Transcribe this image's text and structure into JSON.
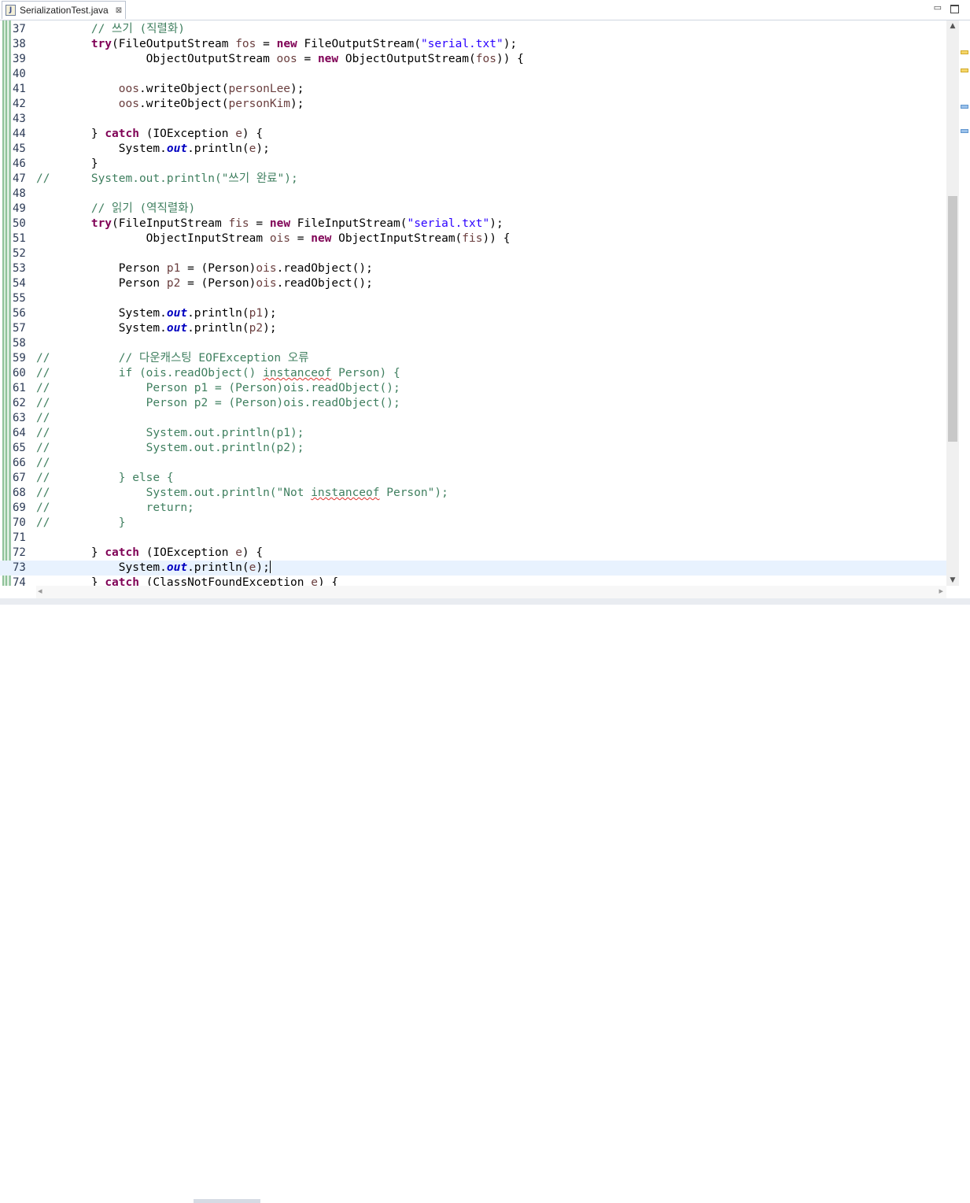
{
  "tab": {
    "title": "SerializationTest.java",
    "close": "⊠",
    "icon_text": "J"
  },
  "window": {
    "minimize": "▭",
    "maximize": "□"
  },
  "editor": {
    "current_line": 73,
    "lines": [
      {
        "n": "37",
        "html": "        <span class=\"cm\">// 쓰기 (직렬화)</span>"
      },
      {
        "n": "38",
        "html": "        <span class=\"kw\">try</span>(FileOutputStream <span class=\"var\">fos</span> = <span class=\"kw\">new</span> FileOutputStream(<span class=\"str\">\"serial.txt\"</span>);"
      },
      {
        "n": "39",
        "html": "                ObjectOutputStream <span class=\"var\">oos</span> = <span class=\"kw\">new</span> ObjectOutputStream(<span class=\"var\">fos</span>)) {"
      },
      {
        "n": "40",
        "html": ""
      },
      {
        "n": "41",
        "html": "            <span class=\"var\">oos</span>.writeObject(<span class=\"var\">personLee</span>);"
      },
      {
        "n": "42",
        "html": "            <span class=\"var\">oos</span>.writeObject(<span class=\"var\">personKim</span>);"
      },
      {
        "n": "43",
        "html": ""
      },
      {
        "n": "44",
        "html": "        } <span class=\"kw\">catch</span> (IOException <span class=\"var\">e</span>) {"
      },
      {
        "n": "45",
        "html": "            System.<span class=\"fld\">out</span>.println(<span class=\"var\">e</span>);"
      },
      {
        "n": "46",
        "html": "        }"
      },
      {
        "n": "47",
        "html": "<span class=\"cm\">//      System.out.println(\"쓰기 완료\");</span>"
      },
      {
        "n": "48",
        "html": ""
      },
      {
        "n": "49",
        "html": "        <span class=\"cm\">// 읽기 (역직렬화)</span>"
      },
      {
        "n": "50",
        "html": "        <span class=\"kw\">try</span>(FileInputStream <span class=\"var\">fis</span> = <span class=\"kw\">new</span> FileInputStream(<span class=\"str\">\"serial.txt\"</span>);"
      },
      {
        "n": "51",
        "html": "                ObjectInputStream <span class=\"var\">ois</span> = <span class=\"kw\">new</span> ObjectInputStream(<span class=\"var\">fis</span>)) {"
      },
      {
        "n": "52",
        "html": ""
      },
      {
        "n": "53",
        "html": "            Person <span class=\"var\">p1</span> = (Person)<span class=\"var\">ois</span>.readObject();"
      },
      {
        "n": "54",
        "html": "            Person <span class=\"var\">p2</span> = (Person)<span class=\"var\">ois</span>.readObject();"
      },
      {
        "n": "55",
        "html": ""
      },
      {
        "n": "56",
        "html": "            System.<span class=\"fld\">out</span>.println(<span class=\"var\">p1</span>);"
      },
      {
        "n": "57",
        "html": "            System.<span class=\"fld\">out</span>.println(<span class=\"var\">p2</span>);"
      },
      {
        "n": "58",
        "html": ""
      },
      {
        "n": "59",
        "html": "<span class=\"cm\">//          // 다운캐스팅 EOFException 오류</span>"
      },
      {
        "n": "60",
        "html": "<span class=\"cm\">//          if (ois.readObject() <span class=\"err\">instanceof</span> Person) {</span>"
      },
      {
        "n": "61",
        "html": "<span class=\"cm\">//              Person p1 = (Person)ois.readObject();</span>"
      },
      {
        "n": "62",
        "html": "<span class=\"cm\">//              Person p2 = (Person)ois.readObject();</span>"
      },
      {
        "n": "63",
        "html": "<span class=\"cm\">//</span>"
      },
      {
        "n": "64",
        "html": "<span class=\"cm\">//              System.out.println(p1);</span>"
      },
      {
        "n": "65",
        "html": "<span class=\"cm\">//              System.out.println(p2);</span>"
      },
      {
        "n": "66",
        "html": "<span class=\"cm\">//</span>"
      },
      {
        "n": "67",
        "html": "<span class=\"cm\">//          } else {</span>"
      },
      {
        "n": "68",
        "html": "<span class=\"cm\">//              System.out.println(\"Not <span class=\"err\">instanceof</span> Person\");</span>"
      },
      {
        "n": "69",
        "html": "<span class=\"cm\">//              return;</span>"
      },
      {
        "n": "70",
        "html": "<span class=\"cm\">//          }</span>"
      },
      {
        "n": "71",
        "html": ""
      },
      {
        "n": "72",
        "html": "        } <span class=\"kw\">catch</span> (IOException <span class=\"var\">e</span>) {"
      },
      {
        "n": "73",
        "html": "            System.<span class=\"fld\">out</span>.println(<span class=\"var\">e</span>);<span class=\"caret\"></span>"
      },
      {
        "n": "74",
        "html": "        } <span class=\"kw\">catch</span> (ClassNotFoundException <span class=\"var\">e</span>) {"
      }
    ]
  },
  "scroll": {
    "up": "▲",
    "down": "▼",
    "left": "◂",
    "right": "▸",
    "vertical_position": 0.44
  },
  "overview_marks": [
    {
      "line": 38,
      "color": "#f5d66a"
    },
    {
      "line": 41,
      "color": "#f5d66a"
    },
    {
      "line": 47,
      "color": "#9cc2ea"
    },
    {
      "line": 51,
      "color": "#9cc2ea"
    }
  ]
}
